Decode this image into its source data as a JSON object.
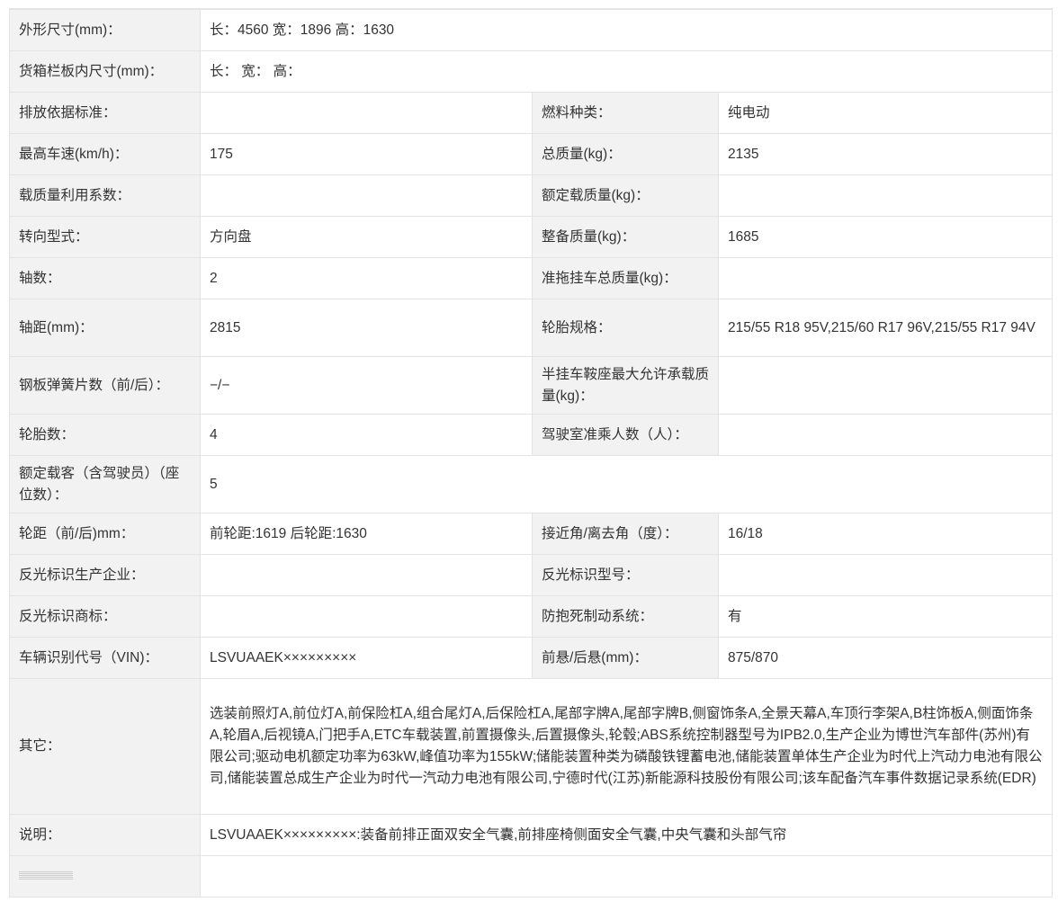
{
  "rows": [
    {
      "l1": "外形尺寸(mm)：",
      "v1": "长：4560 宽：1896 高：1630"
    },
    {
      "l1": "货箱栏板内尺寸(mm)：",
      "v1": "长： 宽： 高："
    },
    {
      "l1": "排放依据标准：",
      "v1": "",
      "l2": "燃料种类：",
      "v2": "纯电动"
    },
    {
      "l1": "最高车速(km/h)：",
      "v1": "175",
      "l2": "总质量(kg)：",
      "v2": "2135"
    },
    {
      "l1": "载质量利用系数：",
      "v1": "",
      "l2": "额定载质量(kg)：",
      "v2": ""
    },
    {
      "l1": "转向型式：",
      "v1": "方向盘",
      "l2": "整备质量(kg)：",
      "v2": "1685"
    },
    {
      "l1": "轴数：",
      "v1": "2",
      "l2": "准拖挂车总质量(kg)：",
      "v2": ""
    },
    {
      "l1": "轴距(mm)：",
      "v1": "2815",
      "l2": "轮胎规格：",
      "v2": "215/55 R18 95V,215/60 R17 96V,215/55 R17 94V"
    },
    {
      "l1": "钢板弹簧片数（前/后）：",
      "v1": "−/−",
      "l2": "半挂车鞍座最大允许承载质量(kg)：",
      "v2": ""
    },
    {
      "l1": "轮胎数：",
      "v1": "4",
      "l2": "驾驶室准乘人数（人）：",
      "v2": ""
    },
    {
      "l1": "额定载客（含驾驶员）（座位数）：",
      "v1": "5"
    },
    {
      "l1": "轮距（前/后)mm：",
      "v1": "前轮距:1619 后轮距:1630",
      "l2": "接近角/离去角（度）：",
      "v2": "16/18"
    },
    {
      "l1": "反光标识生产企业：",
      "v1": "",
      "l2": "反光标识型号：",
      "v2": ""
    },
    {
      "l1": "反光标识商标：",
      "v1": "",
      "l2": "防抱死制动系统：",
      "v2": "有"
    },
    {
      "l1": "车辆识别代号（VIN)：",
      "v1": "LSVUAAEK×××××××××",
      "l2": "前悬/后悬(mm)：",
      "v2": "875/870"
    },
    {
      "l1": "其它：",
      "v1": "选装前照灯A,前位灯A,前保险杠A,组合尾灯A,后保险杠A,尾部字牌A,尾部字牌B,侧窗饰条A,全景天幕A,车顶行李架A,B柱饰板A,侧面饰条A,轮眉A,后视镜A,门把手A,ETC车载装置,前置摄像头,后置摄像头,轮毂;ABS系统控制器型号为IPB2.0,生产企业为博世汽车部件(苏州)有限公司;驱动电机额定功率为63kW,峰值功率为155kW;储能装置种类为磷酸铁锂蓄电池,储能装置单体生产企业为时代上汽动力电池有限公司,储能装置总成生产企业为时代一汽动力电池有限公司,宁德时代(江苏)新能源科技股份有限公司;该车配备汽车事件数据记录系统(EDR)"
    },
    {
      "l1": "说明：",
      "v1": "LSVUAAEK×××××××××:装备前排正面双安全气囊,前排座椅侧面安全气囊,中央气囊和头部气帘"
    }
  ]
}
